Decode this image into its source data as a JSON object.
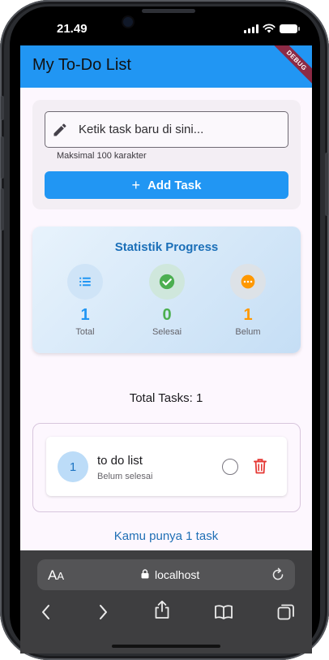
{
  "status_bar": {
    "time": "21.49"
  },
  "app_bar": {
    "title": "My To-Do List",
    "debug_label": "DEBUG",
    "color": "#2196f3"
  },
  "input_section": {
    "placeholder": "Ketik task baru di sini...",
    "value": "",
    "helper_text": "Maksimal 100 karakter",
    "add_button_label": "Add Task",
    "add_icon": "+"
  },
  "stats": {
    "title": "Statistik Progress",
    "items": [
      {
        "icon": "list-icon",
        "value": "1",
        "label": "Total",
        "color": "#2196f3",
        "bg": "#cfe4f7"
      },
      {
        "icon": "check-circle-icon",
        "value": "0",
        "label": "Selesai",
        "color": "#4caf50",
        "bg": "#cfe7dc"
      },
      {
        "icon": "pending-icon",
        "value": "1",
        "label": "Belum",
        "color": "#ff9800",
        "bg": "#dde2e7"
      }
    ]
  },
  "total_tasks_text": "Total Tasks: 1",
  "tasks": [
    {
      "number": "1",
      "title": "to do list",
      "status": "Belum selesai",
      "completed": false
    }
  ],
  "footer_text": "Kamu punya 1 task",
  "browser": {
    "aa_label_big": "A",
    "aa_label_small": "A",
    "url": "localhost"
  }
}
